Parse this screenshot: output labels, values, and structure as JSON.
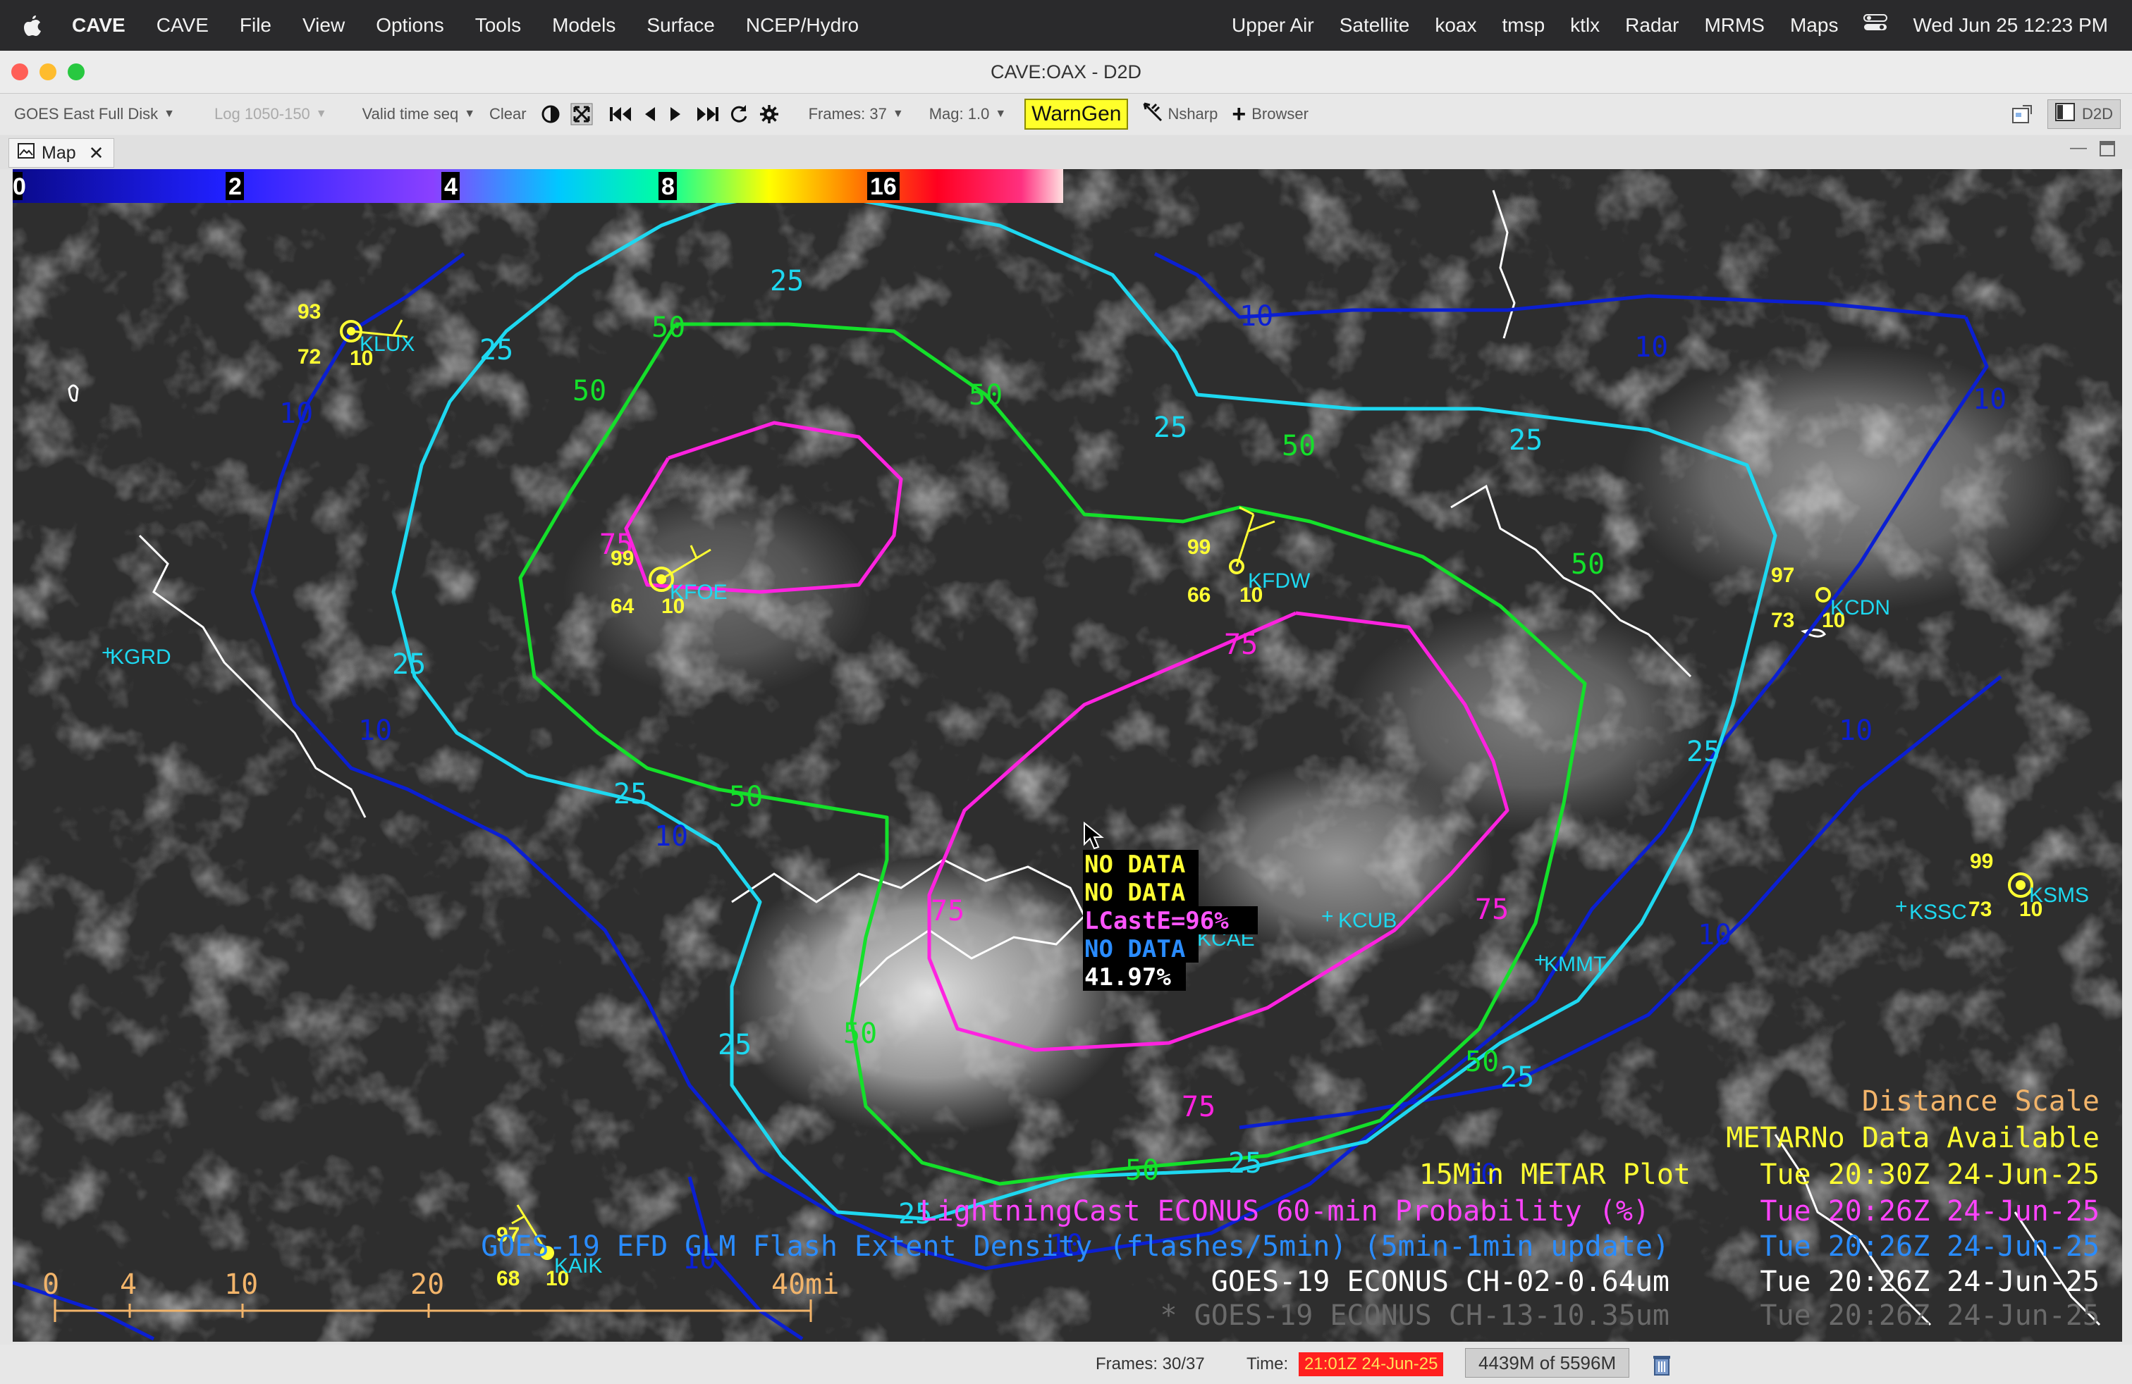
{
  "menubar": {
    "app_name": "CAVE",
    "items": [
      "CAVE",
      "File",
      "View",
      "Options",
      "Tools",
      "Models",
      "Surface",
      "NCEP/Hydro"
    ],
    "right_items": [
      "Upper Air",
      "Satellite",
      "koax",
      "tmsp",
      "ktlx",
      "Radar",
      "MRMS",
      "Maps"
    ],
    "clock": "Wed Jun 25  12:23 PM"
  },
  "window": {
    "title": "CAVE:OAX - D2D"
  },
  "toolbar": {
    "source": "GOES East Full Disk",
    "log": "Log 1050-150",
    "valid_time": "Valid time seq",
    "clear": "Clear",
    "frames": "Frames: 37",
    "mag": "Mag: 1.0",
    "warngen": "WarnGen",
    "nsharp": "Nsharp",
    "browser": "Browser",
    "perspective": "D2D"
  },
  "tab": {
    "label": "Map"
  },
  "colorbar": {
    "labels": [
      "0",
      "2",
      "4",
      "8",
      "16"
    ]
  },
  "contour_labels": {
    "ten": "10",
    "twentyfive": "25",
    "fifty": "50",
    "seventyfive": "75"
  },
  "stations": [
    {
      "id": "KLUX",
      "t": "93",
      "d": "72",
      "v": "10"
    },
    {
      "id": "KFOE",
      "t": "99",
      "d": "64",
      "v": "10"
    },
    {
      "id": "KFDW",
      "t": "99",
      "d": "66",
      "v": "10"
    },
    {
      "id": "KCDN",
      "t": "97",
      "d": "73",
      "v": "10"
    },
    {
      "id": "KSMS",
      "t": "99",
      "d": "73",
      "v": "10"
    },
    {
      "id": "KAIK",
      "t": "97",
      "d": "68",
      "v": "10"
    },
    {
      "id": "KGRD"
    },
    {
      "id": "KCUB"
    },
    {
      "id": "KMMT"
    },
    {
      "id": "KSSC"
    },
    {
      "id": "KCAE"
    }
  ],
  "sample_readout": [
    "NO DATA",
    "NO DATA",
    "LCastE=96%",
    "NO DATA",
    "41.97%"
  ],
  "legend": [
    {
      "text": "Distance Scale",
      "time": "",
      "color": "#f2b46a"
    },
    {
      "text": "METARNo Data Available",
      "time": "",
      "color": "#ffff33"
    },
    {
      "text": "15Min METAR Plot",
      "time": "Tue 20:30Z 24-Jun-25",
      "color": "#ffff33"
    },
    {
      "text": "LightningCast ECONUS 60-min Probability  (%)",
      "time": "Tue 20:26Z 24-Jun-25",
      "color": "#ff44ff"
    },
    {
      "text": "GOES-19 EFD GLM Flash Extent Density (flashes/5min) (5min-1min update)",
      "time": "Tue 20:26Z 24-Jun-25",
      "color": "#2a8cff"
    },
    {
      "text": "GOES-19 ECONUS CH-02-0.64um",
      "time": "Tue 20:26Z 24-Jun-25",
      "color": "#ffffff"
    },
    {
      "text": "* GOES-19 ECONUS CH-13-10.35um",
      "time": "Tue 20:26Z 24-Jun-25",
      "color": "#6a6a6a"
    }
  ],
  "scale": {
    "labels": [
      "0",
      "4",
      "10",
      "20",
      "40mi"
    ]
  },
  "status": {
    "frames": "Frames:  30/37",
    "time_label": "Time:",
    "time_value": "21:01Z 24-Jun-25",
    "memory": "4439M of 5596M"
  }
}
